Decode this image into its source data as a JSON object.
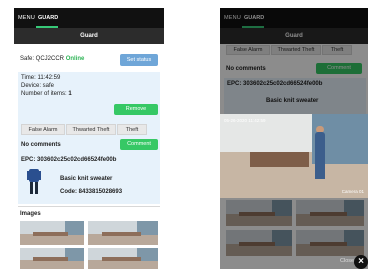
{
  "nav": {
    "menu_label": "MENU",
    "guard_label": "GUARD",
    "accent": "#37c978"
  },
  "header": {
    "title": "Guard"
  },
  "safe": {
    "label": "Safe: QCJ2CCR",
    "status": "Online",
    "set_status_label": "Set status"
  },
  "alarm": {
    "time": "Time: 11:42:59",
    "device": "Device: safe",
    "items_label": "Number of items:",
    "items_count": "1",
    "remove_label": "Remove"
  },
  "actions": [
    "False Alarm",
    "Thwarted Theft",
    "Theft"
  ],
  "comments": {
    "text": "No comments",
    "button_label": "Comment"
  },
  "epc": {
    "label": "EPC: 303602c25c02cd66524fe00b",
    "product_name": "Basic knit sweater",
    "product_code": "Code: 8433815028693"
  },
  "images": {
    "heading": "Images"
  },
  "video": {
    "timestamp": "05-26-2020 11:42:59",
    "camera": "Camera 01"
  },
  "right_panel": {
    "close_label": "Close"
  },
  "colors": {
    "blue_button": "#6fa6d8",
    "green_button": "#36c865",
    "panel": "#e7f2fb"
  }
}
